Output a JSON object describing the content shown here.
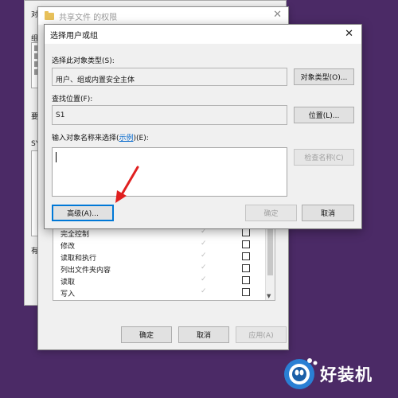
{
  "colors": {
    "desktop": "#4b2a66",
    "link": "#0066cc",
    "focus": "#0078d7",
    "arrow": "#e02020",
    "logo_badge": "#2a7fd4"
  },
  "props_window": {
    "labels": [
      "对",
      "组",
      "要",
      "SY",
      "有"
    ]
  },
  "perm_window": {
    "title": "共享文件 的权限",
    "permissions": [
      {
        "name": "完全控制"
      },
      {
        "name": "修改"
      },
      {
        "name": "读取和执行"
      },
      {
        "name": "列出文件夹内容"
      },
      {
        "name": "读取"
      },
      {
        "name": "写入"
      }
    ],
    "buttons": {
      "ok": "确定",
      "cancel": "取消",
      "apply": "应用(A)"
    }
  },
  "select_dialog": {
    "title": "选择用户或组",
    "object_type_label": "选择此对象类型(S):",
    "object_type_value": "用户、组或内置安全主体",
    "object_types_button": "对象类型(O)...",
    "location_label": "查找位置(F):",
    "location_value": "S1",
    "locations_button": "位置(L)...",
    "names_label_pre": "输入对象名称来选择(",
    "names_label_link": "示例",
    "names_label_post": ")(E):",
    "names_value": "",
    "check_names_button": "检查名称(C)",
    "advanced_button": "高级(A)...",
    "ok_button": "确定",
    "cancel_button": "取消"
  },
  "logo": {
    "text": "好装机"
  }
}
